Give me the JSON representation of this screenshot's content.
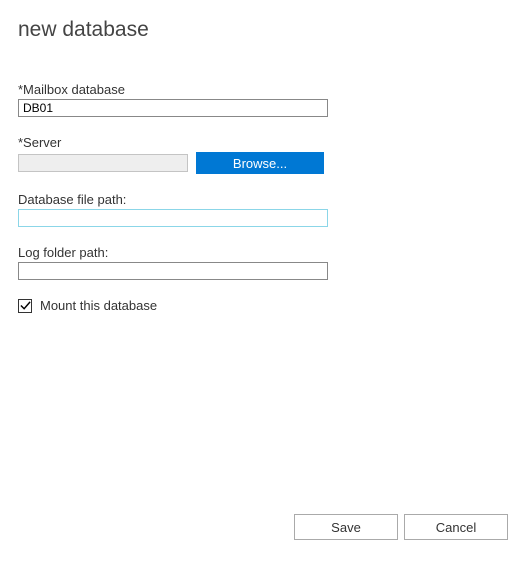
{
  "title": "new database",
  "fields": {
    "mailbox_db": {
      "label": "*Mailbox database",
      "value": "DB01"
    },
    "server": {
      "label": "*Server",
      "value": "",
      "browse_label": "Browse..."
    },
    "db_file_path": {
      "label": "Database file path:",
      "value": ""
    },
    "log_folder_path": {
      "label": "Log folder path:",
      "value": ""
    }
  },
  "mount": {
    "label": "Mount this database",
    "checked": true
  },
  "footer": {
    "save_label": "Save",
    "cancel_label": "Cancel"
  }
}
